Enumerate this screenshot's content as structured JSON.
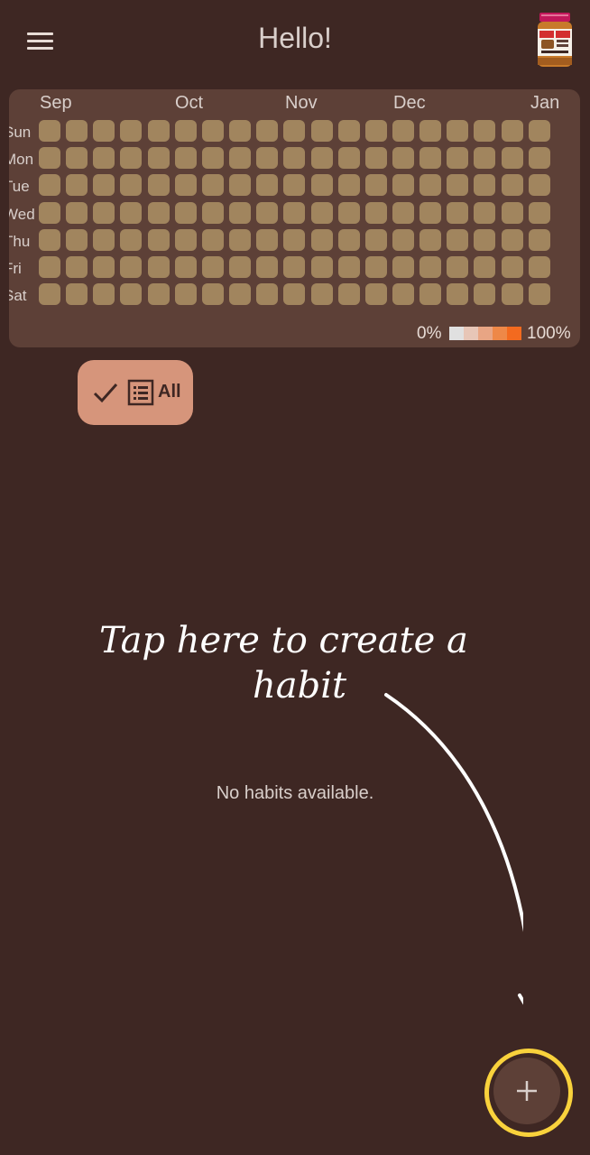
{
  "header": {
    "title": "Hello!"
  },
  "heatmap": {
    "months": [
      "Sep",
      "Oct",
      "Nov",
      "Dec",
      "Jan"
    ],
    "weekdays": [
      "Sun",
      "Mon",
      "Tue",
      "Wed",
      "Thu",
      "Fri",
      "Sat"
    ],
    "weeks": 19,
    "legend": {
      "low": "0%",
      "high": "100%"
    },
    "colors": {
      "empty_cell": "#a1855e",
      "scale": [
        "#e0e0e0",
        "#e7c6b7",
        "#e8a584",
        "#ee8848",
        "#f36a1f"
      ]
    }
  },
  "filter": {
    "label": "All"
  },
  "hint": {
    "line1": "Tap here to create a",
    "line2": "habit"
  },
  "empty_state": "No habits available.",
  "fab": {
    "icon": "plus-icon",
    "accent": "#f9d23c"
  }
}
